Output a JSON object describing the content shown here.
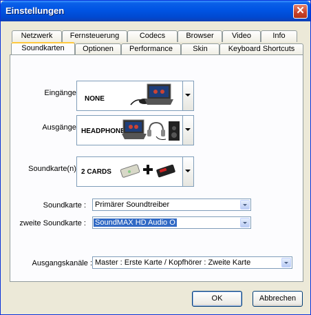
{
  "window": {
    "title": "Einstellungen",
    "close_glyph": "✕"
  },
  "tabs_back": [
    "Netzwerk",
    "Fernsteuerung",
    "Codecs",
    "Browser",
    "Video",
    "Info"
  ],
  "tabs_front": [
    "Soundkarten",
    "Optionen",
    "Performance",
    "Skin",
    "Keyboard Shortcuts"
  ],
  "active_tab": "Soundkarten",
  "soundkarten": {
    "eingaenge_label": "Eingänge :",
    "eingaenge_value": "NONE",
    "ausgaenge_label": "Ausgänge :",
    "ausgaenge_value": "HEADPHONES",
    "soundkarten_label": "Soundkarte(n) :",
    "soundkarten_value": "2 CARDS",
    "soundkarte_label": "Soundkarte :",
    "soundkarte_value": "Primärer Soundtreiber",
    "zweite_label": "zweite Soundkarte :",
    "zweite_value": "SoundMAX HD Audio O",
    "kanaele_label": "Ausgangskanäle :",
    "kanaele_value": "Master : Erste Karte / Kopfhörer : Zweite Karte"
  },
  "buttons": {
    "ok": "OK",
    "cancel": "Abbrechen"
  },
  "colors": {
    "titlebar": "#0054E3",
    "selection": "#316AC5",
    "close": "#C6412A",
    "active_tab_highlight": "#FFC83C"
  }
}
